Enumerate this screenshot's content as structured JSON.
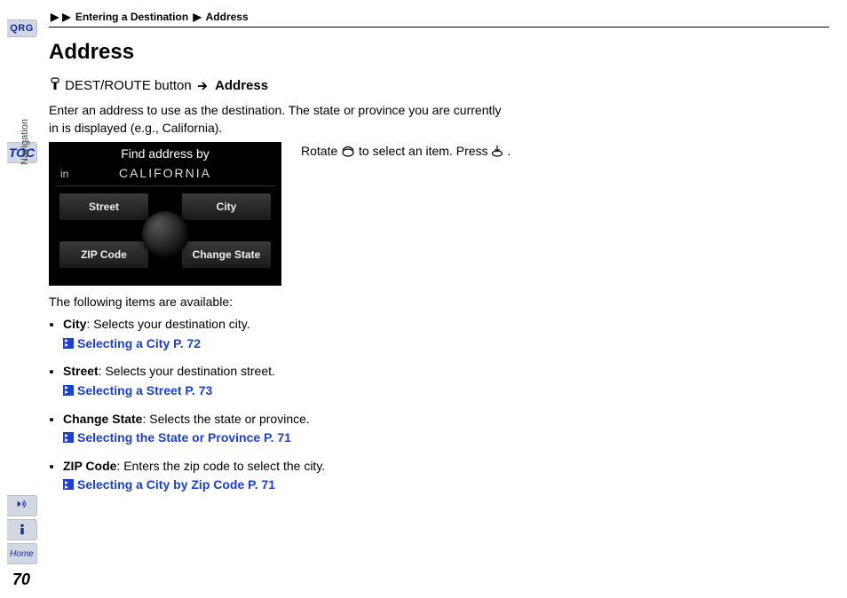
{
  "breadcrumb": {
    "a": "Entering a Destination",
    "b": "Address"
  },
  "title": "Address",
  "path": {
    "btn": "DEST/ROUTE button",
    "dest": "Address"
  },
  "intro": "Enter an address to use as the destination. The state or province you are currently in is displayed (e.g., California).",
  "caption_a": "Rotate ",
  "caption_b": " to select an item. Press ",
  "caption_c": ".",
  "screen": {
    "title": "Find address by",
    "in": "in",
    "state": "CALIFORNIA",
    "street": "Street",
    "city": "City",
    "zip": "ZIP Code",
    "change": "Change State"
  },
  "following": "The following items are available:",
  "items": [
    {
      "name": "City",
      "desc": ": Selects your destination city.",
      "ref": "Selecting a City",
      "pg": "P. 72"
    },
    {
      "name": "Street",
      "desc": ": Selects your destination street.",
      "ref": "Selecting a Street",
      "pg": "P. 73"
    },
    {
      "name": "Change State",
      "desc": ": Selects the state or province.",
      "ref": "Selecting the State or Province",
      "pg": "P. 71"
    },
    {
      "name": "ZIP Code",
      "desc": ": Enters the zip code to select the city.",
      "ref": "Selecting a City by Zip Code",
      "pg": "P. 71"
    }
  ],
  "side": {
    "qrg": "QRG",
    "toc": "TOC",
    "section": "Navigation",
    "home": "Home",
    "page": "70"
  }
}
